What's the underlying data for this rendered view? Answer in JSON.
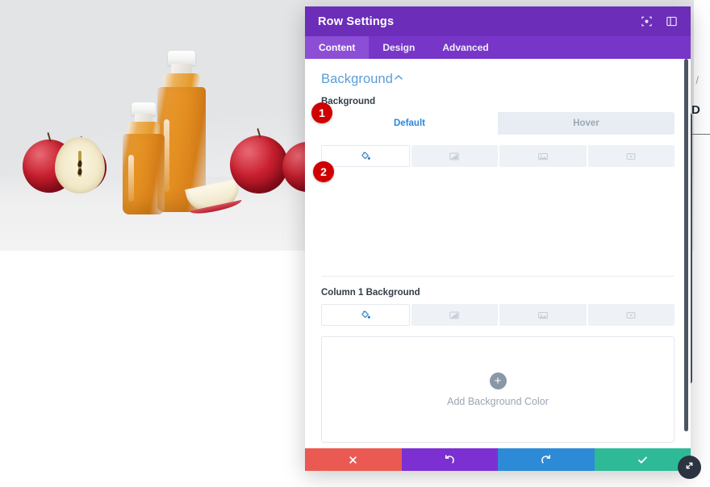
{
  "page": {
    "hero_photo_alt": "apple-juice-bottles-photo",
    "behind_text": "D D",
    "behind_tilde": "/"
  },
  "modal": {
    "title": "Row Settings",
    "header_icons": [
      {
        "name": "focus-target-icon"
      },
      {
        "name": "layout-panel-icon"
      }
    ],
    "tabs": [
      {
        "label": "Content",
        "active": true
      },
      {
        "label": "Design",
        "active": false
      },
      {
        "label": "Advanced",
        "active": false
      }
    ],
    "section": {
      "title": "Background",
      "collapse_icon": "chevron-up-icon"
    },
    "background_field": {
      "label": "Background",
      "state_toggle": [
        {
          "label": "Default",
          "active": true
        },
        {
          "label": "Hover",
          "active": false
        }
      ],
      "types": [
        {
          "name": "background-color-icon",
          "active": true
        },
        {
          "name": "background-gradient-icon",
          "active": false
        },
        {
          "name": "background-image-icon",
          "active": false
        },
        {
          "name": "background-video-icon",
          "active": false
        }
      ]
    },
    "column_field": {
      "label": "Column 1 Background",
      "types": [
        {
          "name": "background-color-icon",
          "active": true
        },
        {
          "name": "background-gradient-icon",
          "active": false
        },
        {
          "name": "background-image-icon",
          "active": false
        },
        {
          "name": "background-video-icon",
          "active": false
        }
      ],
      "dropzone": {
        "plus": "+",
        "label": "Add Background Color"
      }
    },
    "footer": [
      {
        "name": "cancel-button",
        "icon": "close-x-icon"
      },
      {
        "name": "undo-button",
        "icon": "undo-arrow-icon"
      },
      {
        "name": "redo-button",
        "icon": "redo-arrow-icon"
      },
      {
        "name": "save-button",
        "icon": "check-icon"
      }
    ]
  },
  "callouts": [
    {
      "number": "1"
    },
    {
      "number": "2"
    }
  ],
  "colors": {
    "header_purple": "#6C2EB9",
    "tab_purple": "#7836C9",
    "tab_active_purple": "#8D4ED6",
    "section_title_blue": "#5B9DD9",
    "active_blue": "#2B87DA",
    "cancel_red": "#EA5A52",
    "undo_purple": "#7C30D1",
    "redo_blue": "#2C8AD6",
    "save_green": "#2EBA97",
    "badge_red": "#CF0000"
  }
}
